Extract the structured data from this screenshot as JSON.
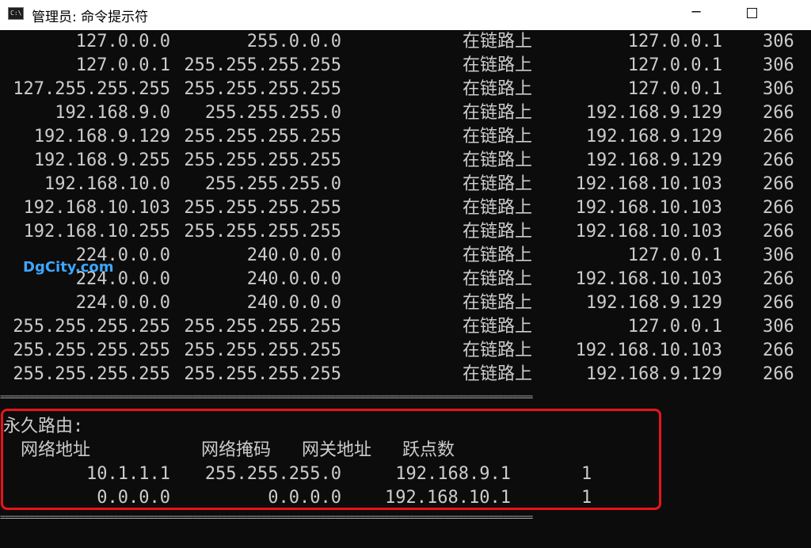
{
  "window": {
    "title": "管理员: 命令提示符",
    "icon_text": "C:\\",
    "minimize_glyph": "─"
  },
  "route_rows": [
    {
      "dest": "127.0.0.0",
      "mask": "255.0.0.0",
      "gateway": "在链路上",
      "interface": "127.0.0.1",
      "metric": "306"
    },
    {
      "dest": "127.0.0.1",
      "mask": "255.255.255.255",
      "gateway": "在链路上",
      "interface": "127.0.0.1",
      "metric": "306"
    },
    {
      "dest": "127.255.255.255",
      "mask": "255.255.255.255",
      "gateway": "在链路上",
      "interface": "127.0.0.1",
      "metric": "306"
    },
    {
      "dest": "192.168.9.0",
      "mask": "255.255.255.0",
      "gateway": "在链路上",
      "interface": "192.168.9.129",
      "metric": "266"
    },
    {
      "dest": "192.168.9.129",
      "mask": "255.255.255.255",
      "gateway": "在链路上",
      "interface": "192.168.9.129",
      "metric": "266"
    },
    {
      "dest": "192.168.9.255",
      "mask": "255.255.255.255",
      "gateway": "在链路上",
      "interface": "192.168.9.129",
      "metric": "266"
    },
    {
      "dest": "192.168.10.0",
      "mask": "255.255.255.0",
      "gateway": "在链路上",
      "interface": "192.168.10.103",
      "metric": "266"
    },
    {
      "dest": "192.168.10.103",
      "mask": "255.255.255.255",
      "gateway": "在链路上",
      "interface": "192.168.10.103",
      "metric": "266"
    },
    {
      "dest": "192.168.10.255",
      "mask": "255.255.255.255",
      "gateway": "在链路上",
      "interface": "192.168.10.103",
      "metric": "266"
    },
    {
      "dest": "224.0.0.0",
      "mask": "240.0.0.0",
      "gateway": "在链路上",
      "interface": "127.0.0.1",
      "metric": "306"
    },
    {
      "dest": "224.0.0.0",
      "mask": "240.0.0.0",
      "gateway": "在链路上",
      "interface": "192.168.10.103",
      "metric": "266"
    },
    {
      "dest": "224.0.0.0",
      "mask": "240.0.0.0",
      "gateway": "在链路上",
      "interface": "192.168.9.129",
      "metric": "266"
    },
    {
      "dest": "255.255.255.255",
      "mask": "255.255.255.255",
      "gateway": "在链路上",
      "interface": "127.0.0.1",
      "metric": "306"
    },
    {
      "dest": "255.255.255.255",
      "mask": "255.255.255.255",
      "gateway": "在链路上",
      "interface": "192.168.10.103",
      "metric": "266"
    },
    {
      "dest": "255.255.255.255",
      "mask": "255.255.255.255",
      "gateway": "在链路上",
      "interface": "192.168.9.129",
      "metric": "266"
    }
  ],
  "separator": "============================================================================================================",
  "persistent": {
    "title": "永久路由:",
    "headers": [
      "网络地址",
      "网络掩码",
      "网关地址",
      "跃点数"
    ],
    "rows": [
      {
        "dest": "10.1.1.1",
        "mask": "255.255.255.0",
        "gateway": "192.168.9.1",
        "metric": "1"
      },
      {
        "dest": "0.0.0.0",
        "mask": "0.0.0.0",
        "gateway": "192.168.10.1",
        "metric": "1"
      }
    ]
  },
  "watermark": "DgCity.com",
  "colors": {
    "console_bg": "#0c0c0c",
    "console_text": "#cccccc",
    "highlight_border": "#e8141b",
    "watermark": "#3ea6ff"
  }
}
